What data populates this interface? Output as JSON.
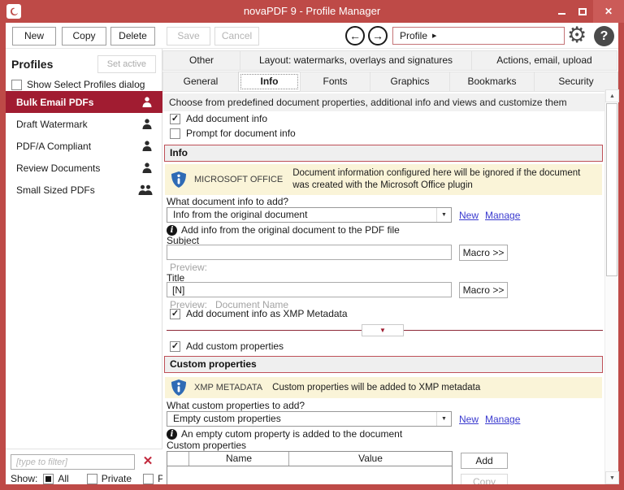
{
  "colors": {
    "titlebar_red": "#BE4A47",
    "selected_profile_red": "#A11C31",
    "section_border_red": "#BE5058",
    "divider_red": "#8E2A38",
    "notice_yellow": "#FAF4D8",
    "shield_blue": "#2F6BB5",
    "link_blue": "#3A3ACF",
    "clear_x_red": "#C2283C"
  },
  "icons": {
    "back": "←",
    "forward": "→",
    "gear": "⚙",
    "help": "?",
    "close": "✕",
    "breadcrumb_caret": "▶",
    "dropdown_caret": "▼",
    "expander_caret": "▼",
    "check": "✓",
    "info": "i",
    "scroll_up": "▲",
    "scroll_down": "▼",
    "clear": "✕"
  },
  "window": {
    "title": "novaPDF 9 - Profile Manager"
  },
  "toolbar": {
    "new_label": "New",
    "copy_label": "Copy",
    "delete_label": "Delete",
    "save_label": "Save",
    "cancel_label": "Cancel",
    "breadcrumb_label": "Profile"
  },
  "sidebar": {
    "title": "Profiles",
    "set_active_label": "Set active",
    "show_select_dialog_label": "Show Select Profiles dialog",
    "profiles": [
      {
        "name": "Bulk Email PDFs"
      },
      {
        "name": "Draft Watermark"
      },
      {
        "name": "PDF/A Compliant"
      },
      {
        "name": "Review Documents"
      },
      {
        "name": "Small Sized PDFs"
      }
    ],
    "filter_placeholder": "[type to filter]",
    "show_label": "Show:",
    "filter_all": "All",
    "filter_private": "Private",
    "filter_public": "Public"
  },
  "tabs": {
    "row1": [
      "Other",
      "Layout: watermarks, overlays and signatures",
      "Actions, email, upload"
    ],
    "row2": [
      "General",
      "Info",
      "Fonts",
      "Graphics",
      "Bookmarks",
      "Security"
    ],
    "active": "Info"
  },
  "content": {
    "description": "Choose from predefined document properties, additional info and views and customize them",
    "add_document_info_label": "Add document info",
    "prompt_document_info_label": "Prompt for document info",
    "info": {
      "section_title": "Info",
      "notice_label": "MICROSOFT OFFICE",
      "notice_text": "Document information configured here will be ignored if the document was created with the Microsoft Office plugin",
      "what_label": "What document info to add?",
      "dropdown_value": "Info from the original document",
      "new_link": "New",
      "manage_link": "Manage",
      "hint": "Add info from the original document to the PDF file",
      "subject_label": "Subject",
      "subject_value": "",
      "macro_label": "Macro >>",
      "preview_label": "Preview:",
      "title_label": "Title",
      "title_value": "[N]",
      "title_preview_label": "Preview:",
      "title_preview_value": "Document Name",
      "xmp_label": "Add document info as XMP Metadata"
    },
    "custom": {
      "add_label": "Add custom properties",
      "section_title": "Custom properties",
      "notice_label": "XMP METADATA",
      "notice_text": "Custom properties will be added to XMP metadata",
      "what_label": "What custom properties to add?",
      "dropdown_value": "Empty custom properties",
      "new_link": "New",
      "manage_link": "Manage",
      "hint": "An empty cutom property is added to the document",
      "table_label": "Custom properties",
      "col_name": "Name",
      "col_value": "Value",
      "add_button": "Add",
      "copy_button": "Copy"
    }
  }
}
